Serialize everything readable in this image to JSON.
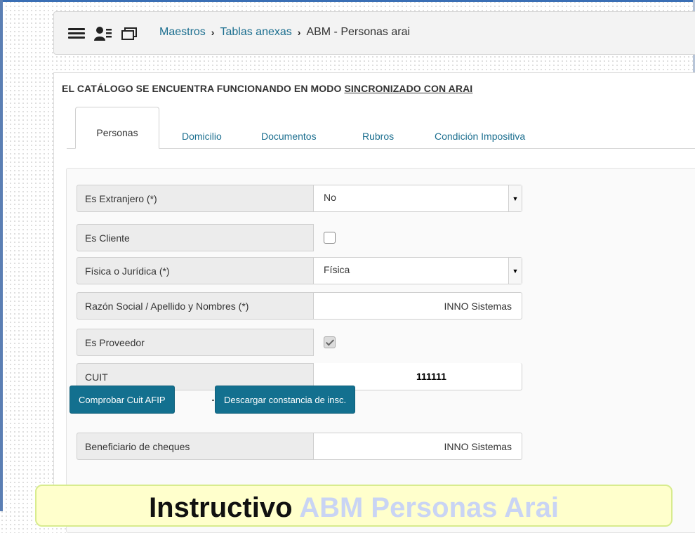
{
  "breadcrumb": {
    "items": [
      "Maestros",
      "Tablas anexas",
      "ABM - Personas arai"
    ],
    "separator": "›"
  },
  "icons": [
    "menu-icon",
    "users-icon",
    "window-icon"
  ],
  "sync_notice": {
    "prefix": "EL CATÁLOGO SE ENCUENTRA FUNCIONANDO EN MODO ",
    "link": "SINCRONIZADO CON ARAI"
  },
  "tabs": [
    {
      "label": "Personas",
      "active": true
    },
    {
      "label": "Domicilio",
      "active": false
    },
    {
      "label": "Documentos",
      "active": false
    },
    {
      "label": "Rubros",
      "active": false
    },
    {
      "label": "Condición Impositiva",
      "active": false
    }
  ],
  "form": {
    "es_extranjero": {
      "label": "Es Extranjero (*)",
      "value": "No"
    },
    "es_cliente": {
      "label": "Es Cliente",
      "checked": false
    },
    "fisica_juridica": {
      "label": "Física o Jurídica (*)",
      "value": "Física"
    },
    "razon_social": {
      "label": "Razón Social / Apellido y Nombres (*)",
      "value": "INNO Sistemas"
    },
    "es_proveedor": {
      "label": "Es Proveedor",
      "checked": true
    },
    "cuit": {
      "label": "CUIT",
      "value": "111111"
    },
    "beneficiario": {
      "label": "Beneficiario de cheques",
      "value": "INNO Sistemas"
    }
  },
  "buttons": {
    "comprobar": "Comprobar Cuit AFIP",
    "descargar": "Descargar constancia de insc."
  },
  "banner": {
    "part1": "Instructivo",
    "part2": "ABM Personas Arai"
  },
  "colors": {
    "accent": "#13708f",
    "link": "#1b6e8f",
    "banner_bg": "#ffffcc"
  }
}
